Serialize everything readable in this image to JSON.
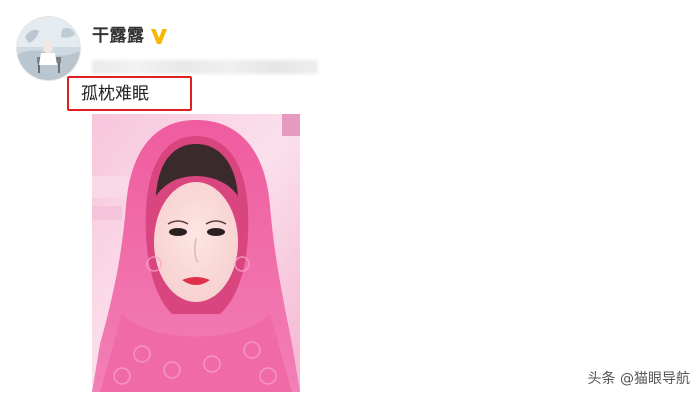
{
  "post": {
    "author_name": "干露露",
    "verified_badge": "verified-v-icon",
    "text": "孤枕难眠",
    "highlight_color": "#e02020",
    "photo_subject": "selfie-pink-headscarf",
    "photo_colors": {
      "scarf": "#f05aa0",
      "background": "#fbd6e6"
    }
  },
  "watermark": {
    "text": "头条 @猫眼导航"
  },
  "colors": {
    "badge": "#f5b700",
    "name_text": "#333333"
  }
}
